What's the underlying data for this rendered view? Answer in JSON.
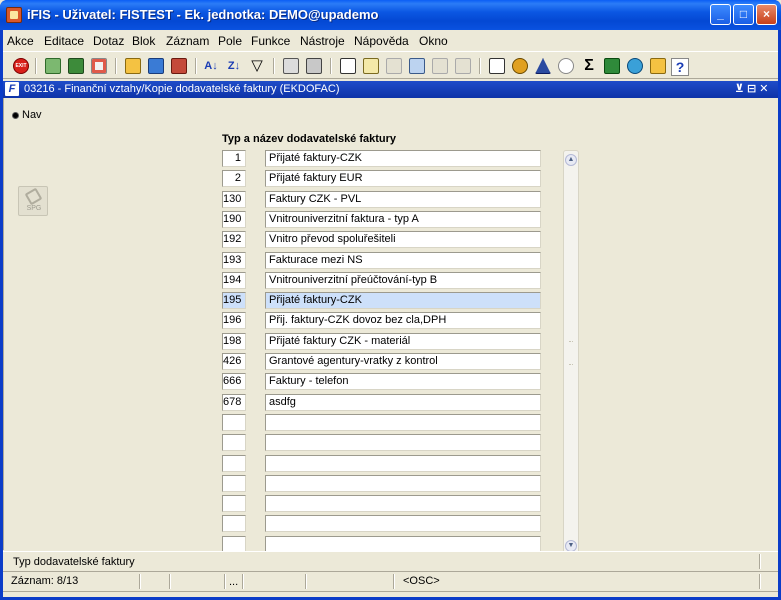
{
  "window": {
    "title": "iFIS - Uživatel: FISTEST - Ek. jednotka: DEMO@upademo",
    "minimize": "_",
    "maximize": "□",
    "close": "×"
  },
  "menu": [
    "Akce",
    "Editace",
    "Dotaz",
    "Blok",
    "Záznam",
    "Pole",
    "Funkce",
    "Nástroje",
    "Nápověda",
    "Okno"
  ],
  "toolbar": {
    "exit_label": "EXIT",
    "sort_asc": "A↓",
    "sort_desc": "Z↓",
    "filter": "▽",
    "sum": "Σ",
    "help": "?"
  },
  "form": {
    "icon": "F",
    "title": "03216 - Finanční vztahy/Kopie dodavatelské faktury (EKDOFAC)",
    "controls": "⊻ ⊟ ✕"
  },
  "nav": {
    "label": "Nav",
    "spg_label": "SPG"
  },
  "table": {
    "header": "Typ a název dodavatelské faktury",
    "rows": [
      {
        "code": "1",
        "name": "Přijaté faktury-CZK"
      },
      {
        "code": "2",
        "name": "Přijaté faktury EUR"
      },
      {
        "code": "130",
        "name": "Faktury CZK - PVL"
      },
      {
        "code": "190",
        "name": "Vnitrouniverzitní faktura - typ A"
      },
      {
        "code": "192",
        "name": "Vnitro převod spoluřešiteli"
      },
      {
        "code": "193",
        "name": "Fakturace mezi NS"
      },
      {
        "code": "194",
        "name": "Vnitrouniverzitní přeúčtování-typ B"
      },
      {
        "code": "195",
        "name": "Přijaté faktury-CZK"
      },
      {
        "code": "196",
        "name": "Přij. faktury-CZK dovoz bez cla,DPH"
      },
      {
        "code": "198",
        "name": "Přijaté faktury CZK - materiál"
      },
      {
        "code": "426",
        "name": "Grantové agentury-vratky z kontrol"
      },
      {
        "code": "666",
        "name": "Faktury - telefon"
      },
      {
        "code": "678",
        "name": "asdfg"
      },
      {
        "code": "",
        "name": ""
      },
      {
        "code": "",
        "name": ""
      },
      {
        "code": "",
        "name": ""
      },
      {
        "code": "",
        "name": ""
      },
      {
        "code": "",
        "name": ""
      },
      {
        "code": "",
        "name": ""
      },
      {
        "code": "",
        "name": ""
      }
    ],
    "selected_index": 7
  },
  "status": {
    "hint": "Typ dodavatelské faktury",
    "record": "Záznam: 8/13",
    "ellipsis": "...",
    "mode": "<OSC>"
  }
}
